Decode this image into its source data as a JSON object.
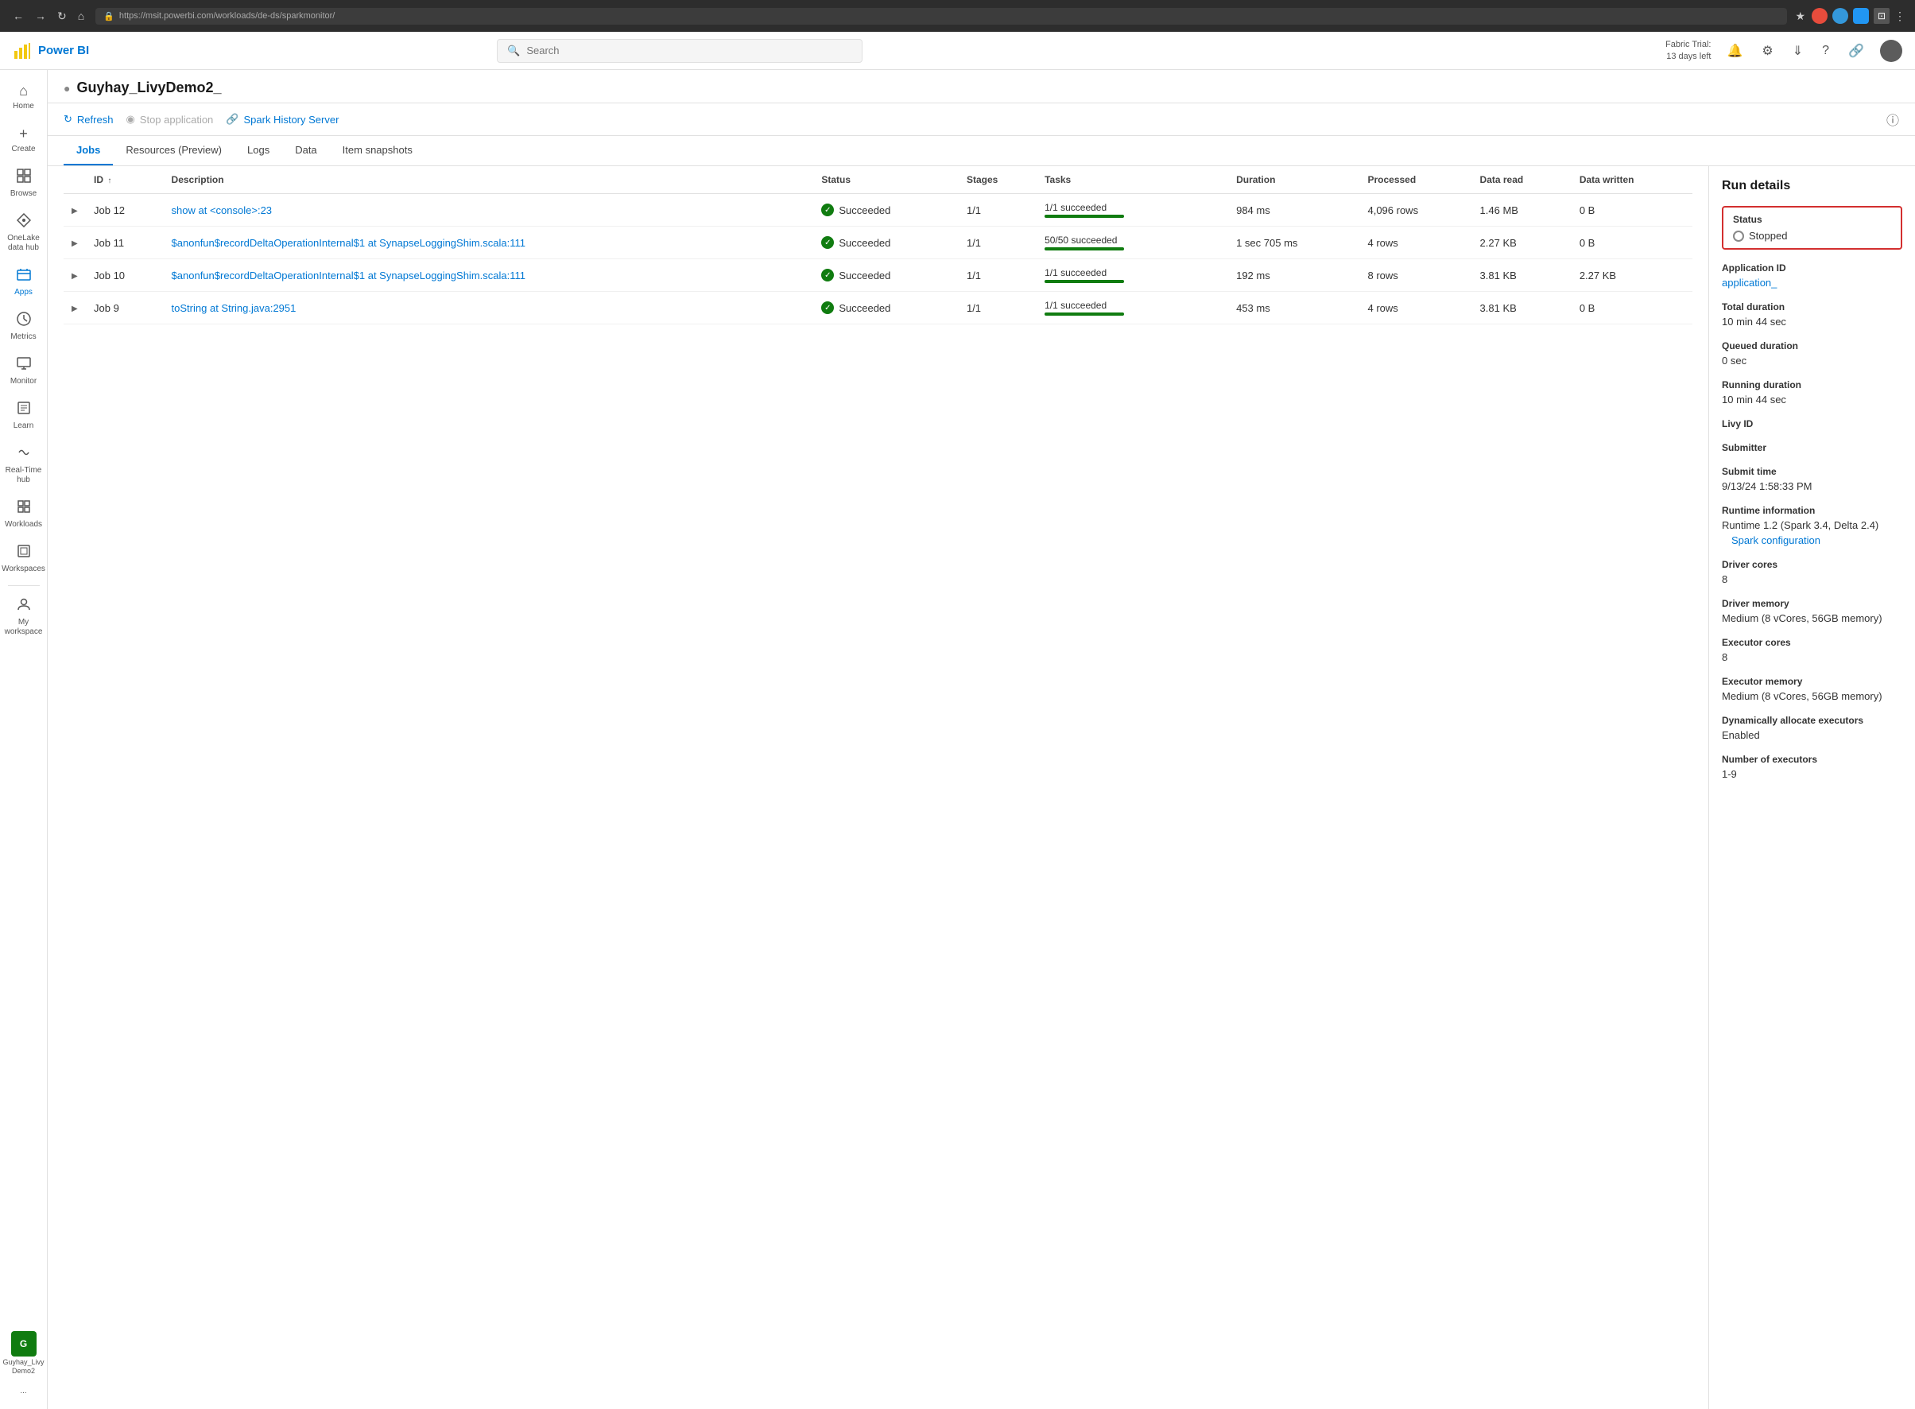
{
  "browser": {
    "url": "https://msit.powerbi.com/workloads/de-ds/sparkmonitor/",
    "back_btn": "←",
    "fwd_btn": "→",
    "refresh_btn": "↻",
    "home_btn": "⌂"
  },
  "topbar": {
    "app_name": "Power BI",
    "search_placeholder": "Search",
    "trial_line1": "Fabric Trial:",
    "trial_line2": "13 days left"
  },
  "page": {
    "title": "Guyhay_LivyDemo2_",
    "icon": "●"
  },
  "toolbar": {
    "refresh_label": "Refresh",
    "stop_label": "Stop application",
    "spark_history_label": "Spark History Server"
  },
  "tabs": [
    {
      "id": "jobs",
      "label": "Jobs",
      "active": true
    },
    {
      "id": "resources",
      "label": "Resources (Preview)",
      "active": false
    },
    {
      "id": "logs",
      "label": "Logs",
      "active": false
    },
    {
      "id": "data",
      "label": "Data",
      "active": false
    },
    {
      "id": "snapshots",
      "label": "Item snapshots",
      "active": false
    }
  ],
  "table": {
    "columns": [
      {
        "id": "expand",
        "label": ""
      },
      {
        "id": "id",
        "label": "ID",
        "sort": "↑"
      },
      {
        "id": "description",
        "label": "Description"
      },
      {
        "id": "status",
        "label": "Status"
      },
      {
        "id": "stages",
        "label": "Stages"
      },
      {
        "id": "tasks",
        "label": "Tasks"
      },
      {
        "id": "duration",
        "label": "Duration"
      },
      {
        "id": "processed",
        "label": "Processed"
      },
      {
        "id": "data_read",
        "label": "Data read"
      },
      {
        "id": "data_written",
        "label": "Data written"
      }
    ],
    "rows": [
      {
        "id": "Job 12",
        "description": "show at <console>:23",
        "status": "Succeeded",
        "stages": "1/1",
        "tasks_label": "1/1 succeeded",
        "tasks_pct": 100,
        "duration": "984 ms",
        "processed": "4,096 rows",
        "data_read": "1.46 MB",
        "data_written": "0 B"
      },
      {
        "id": "Job 11",
        "description": "$anonfun$recordDeltaOperationInternal$1 at SynapseLoggingShim.scala:111",
        "status": "Succeeded",
        "stages": "1/1",
        "tasks_label": "50/50 succeeded",
        "tasks_pct": 100,
        "duration": "1 sec 705 ms",
        "processed": "4 rows",
        "data_read": "2.27 KB",
        "data_written": "0 B"
      },
      {
        "id": "Job 10",
        "description": "$anonfun$recordDeltaOperationInternal$1 at SynapseLoggingShim.scala:111",
        "status": "Succeeded",
        "stages": "1/1",
        "tasks_label": "1/1 succeeded",
        "tasks_pct": 100,
        "duration": "192 ms",
        "processed": "8 rows",
        "data_read": "3.81 KB",
        "data_written": "2.27 KB"
      },
      {
        "id": "Job 9",
        "description": "toString at String.java:2951",
        "status": "Succeeded",
        "stages": "1/1",
        "tasks_label": "1/1 succeeded",
        "tasks_pct": 100,
        "duration": "453 ms",
        "processed": "4 rows",
        "data_read": "3.81 KB",
        "data_written": "0 B"
      }
    ]
  },
  "run_details": {
    "title": "Run details",
    "status_label": "Status",
    "status_value": "Stopped",
    "app_id_label": "Application ID",
    "app_id_value": "application_",
    "total_dur_label": "Total duration",
    "total_dur_value": "10 min 44 sec",
    "queued_dur_label": "Queued duration",
    "queued_dur_value": "0 sec",
    "running_dur_label": "Running duration",
    "running_dur_value": "10 min 44 sec",
    "livy_id_label": "Livy ID",
    "livy_id_value": "",
    "submitter_label": "Submitter",
    "submitter_value": "",
    "submit_time_label": "Submit time",
    "submit_time_value": "9/13/24 1:58:33 PM",
    "runtime_label": "Runtime information",
    "runtime_value": "Runtime 1.2 (Spark 3.4, Delta 2.4)",
    "spark_config_label": "Spark configuration",
    "driver_cores_label": "Driver cores",
    "driver_cores_value": "8",
    "driver_memory_label": "Driver memory",
    "driver_memory_value": "Medium (8 vCores, 56GB memory)",
    "executor_cores_label": "Executor cores",
    "executor_cores_value": "8",
    "executor_memory_label": "Executor memory",
    "executor_memory_value": "Medium (8 vCores, 56GB memory)",
    "dynamic_exec_label": "Dynamically allocate executors",
    "dynamic_exec_value": "Enabled",
    "num_exec_label": "Number of executors",
    "num_exec_value": "1-9"
  },
  "sidebar": {
    "items": [
      {
        "id": "home",
        "icon": "⌂",
        "label": "Home"
      },
      {
        "id": "create",
        "icon": "+",
        "label": "Create"
      },
      {
        "id": "browse",
        "icon": "⊞",
        "label": "Browse"
      },
      {
        "id": "onelake",
        "icon": "◈",
        "label": "OneLake data hub"
      },
      {
        "id": "apps",
        "icon": "⊡",
        "label": "Apps"
      },
      {
        "id": "metrics",
        "icon": "⊘",
        "label": "Metrics"
      },
      {
        "id": "monitor",
        "icon": "○",
        "label": "Monitor"
      },
      {
        "id": "learn",
        "icon": "□",
        "label": "Learn"
      },
      {
        "id": "realtime",
        "icon": "≋",
        "label": "Real-Time hub"
      },
      {
        "id": "workloads",
        "icon": "⊟",
        "label": "Workloads"
      },
      {
        "id": "workspaces",
        "icon": "⊠",
        "label": "Workspaces"
      },
      {
        "id": "my_workspace",
        "icon": "👤",
        "label": "My workspace"
      }
    ],
    "workspace_item": {
      "initials": "G",
      "label": "Guyhay_Livy Demo2"
    },
    "more_label": "..."
  }
}
